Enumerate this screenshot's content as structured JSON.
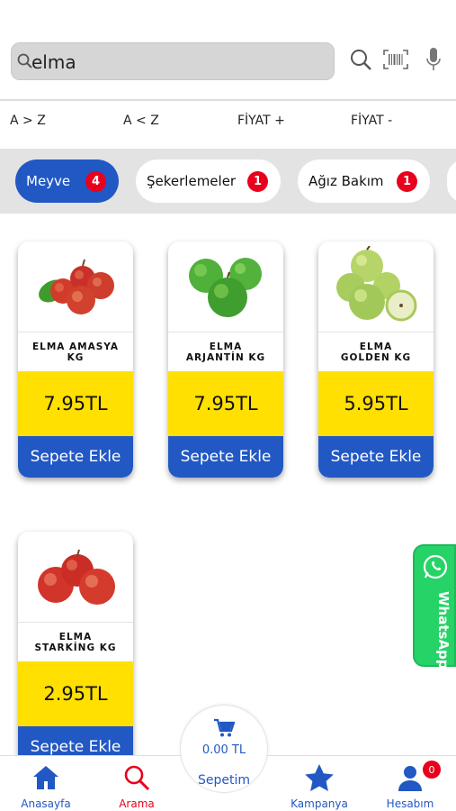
{
  "search": {
    "value": "elma",
    "placeholder": ""
  },
  "sort": {
    "az": "A > Z",
    "za": "A < Z",
    "price_up": "FİYAT +",
    "price_down": "FİYAT -"
  },
  "categories": [
    {
      "label": "Meyve",
      "count": "4",
      "active": true
    },
    {
      "label": "Şekerlemeler",
      "count": "1",
      "active": false
    },
    {
      "label": "Ağız Bakım",
      "count": "1",
      "active": false
    }
  ],
  "products": [
    {
      "name": "ELMA AMASYA\nKG",
      "price": "7.95TL",
      "add_label": "Sepete Ekle",
      "image": "red-apples-icon"
    },
    {
      "name": "ELMA\nARJANTİN KG",
      "price": "7.95TL",
      "add_label": "Sepete Ekle",
      "image": "green-apples-icon"
    },
    {
      "name": "ELMA\nGOLDEN KG",
      "price": "5.95TL",
      "add_label": "Sepete Ekle",
      "image": "golden-apples-icon"
    },
    {
      "name": "ELMA\nSTARKİNG KG",
      "price": "2.95TL",
      "add_label": "Sepete Ekle",
      "image": "starking-apples-icon"
    }
  ],
  "whatsapp": {
    "label": "WhatsApp"
  },
  "cart": {
    "total": "0.00 TL",
    "label": "Sepetim"
  },
  "nav": {
    "home": "Anasayfa",
    "search": "Arama",
    "campaign": "Kampanya",
    "account": "Hesabım",
    "account_badge": "0"
  },
  "colors": {
    "primary": "#2258c4",
    "price_bg": "#ffe000",
    "badge": "#e8001c",
    "whatsapp": "#25d366",
    "search_active": "#e8001c"
  }
}
